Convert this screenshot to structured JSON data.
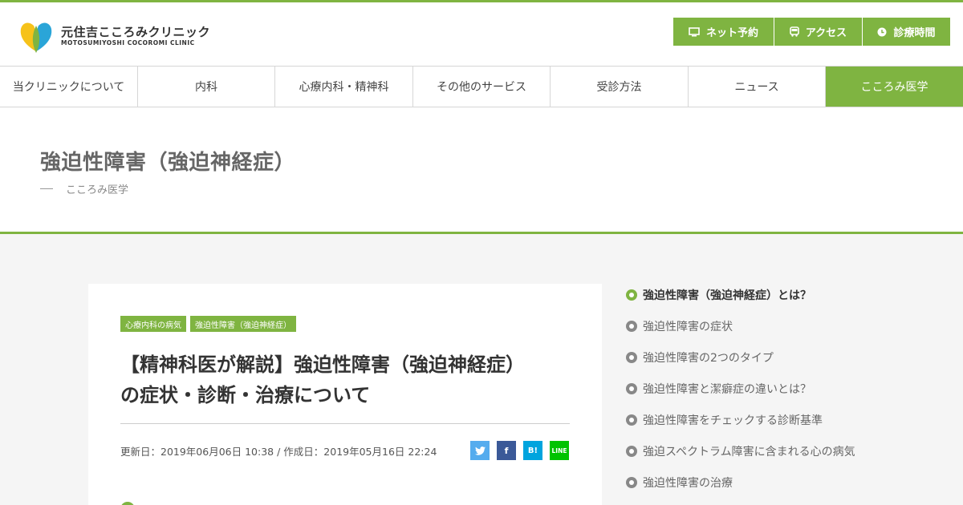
{
  "site": {
    "name_jp": "元住吉こころみクリニック",
    "name_en": "MOTOSUMIYOSHI COCOROMI CLINIC"
  },
  "header_buttons": [
    {
      "label": "ネット予約",
      "icon": "monitor-icon"
    },
    {
      "label": "アクセス",
      "icon": "bus-icon"
    },
    {
      "label": "診療時間",
      "icon": "clock-icon"
    }
  ],
  "nav": [
    {
      "label": "当クリニックについて"
    },
    {
      "label": "内科"
    },
    {
      "label": "心療内科・精神科"
    },
    {
      "label": "その他のサービス"
    },
    {
      "label": "受診方法"
    },
    {
      "label": "ニュース"
    },
    {
      "label": "こころみ医学",
      "active": true
    }
  ],
  "page": {
    "title": "強迫性障害（強迫神経症）",
    "subtitle": "こころみ医学"
  },
  "article": {
    "tags": [
      "心療内科の病気",
      "強迫性障害（強迫神経症）"
    ],
    "title": "【精神科医が解説】強迫性障害（強迫神経症）の症状・診断・治療について",
    "updated": "更新日：2019年06月06日 10:38 /",
    "created": "作成日：2019年05月16日 22:24",
    "share": {
      "twitter": "twitter-icon",
      "facebook": "f",
      "hatena": "B!",
      "line": "LINE"
    }
  },
  "toc": [
    {
      "label": "強迫性障害（強迫神経症）とは？",
      "active": true
    },
    {
      "label": "強迫性障害の症状"
    },
    {
      "label": "強迫性障害の2つのタイプ"
    },
    {
      "label": "強迫性障害と潔癖症の違いとは？"
    },
    {
      "label": "強迫性障害をチェックする診断基準"
    },
    {
      "label": "強迫スペクトラム障害に含まれる心の病気"
    },
    {
      "label": "強迫性障害の治療"
    }
  ],
  "colors": {
    "accent": "#7fb441",
    "twitter": "#55acee",
    "facebook": "#3b5998",
    "hatena": "#00a4de",
    "line": "#00c300"
  }
}
